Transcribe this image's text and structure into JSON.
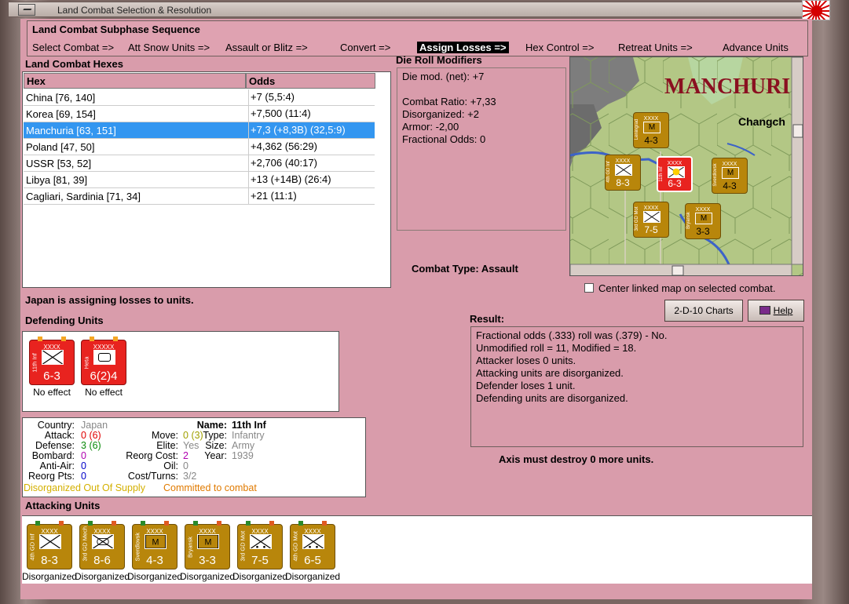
{
  "window": {
    "title": "Land Combat Selection & Resolution"
  },
  "subphase": {
    "header": "Land Combat Subphase Sequence",
    "steps": [
      "Select Combat =>",
      "Att Snow Units =>",
      "Assault or Blitz =>",
      "Convert =>",
      "Assign Losses =>",
      "Hex Control =>",
      "Retreat Units =>",
      "Advance Units"
    ],
    "active_step": "Assign Losses =>"
  },
  "hexes": {
    "label": "Land Combat Hexes",
    "columns": [
      "Hex",
      "Odds"
    ],
    "rows": [
      {
        "hex": "China [76, 140]",
        "odds": "+7 (5,5:4)"
      },
      {
        "hex": "Korea [69, 154]",
        "odds": "+7,500 (11:4)"
      },
      {
        "hex": "Manchuria [63, 151]",
        "odds": "+7,3 (+8,3B) (32,5:9)",
        "selected": true
      },
      {
        "hex": "Poland [47, 50]",
        "odds": "+4,362 (56:29)"
      },
      {
        "hex": "USSR [53, 52]",
        "odds": "+2,706 (40:17)"
      },
      {
        "hex": "Libya [81, 39]",
        "odds": "+13 (+14B) (26:4)"
      },
      {
        "hex": "Cagliari, Sardinia [71, 34]",
        "odds": "+21 (11:1)"
      }
    ]
  },
  "die_roll": {
    "label": "Die Roll Modifiers",
    "lines": [
      "Die mod. (net): +7",
      "",
      "Combat Ratio: +7,33",
      "Disorganized: +2",
      "Armor: -2,00",
      "Fractional Odds: 0"
    ]
  },
  "combat_type": "Combat Type:  Assault",
  "map": {
    "region_label": "MANCHURI",
    "city_label": "Changch",
    "center_checkbox_label": "Center linked map on selected combat."
  },
  "buttons": {
    "charts": "2-D-10 Charts",
    "help": "Help"
  },
  "status_message": "Japan is assigning losses to units.",
  "defending": {
    "label": "Defending Units",
    "units": [
      {
        "size": "XXXX",
        "name": "11th Inf",
        "strength": "6-3",
        "status": "No effect",
        "symbol": "infantry"
      },
      {
        "size": "XXXXX",
        "name": "Heta",
        "strength": "6(2)4",
        "status": "No effect",
        "symbol": "hq"
      }
    ]
  },
  "unit_info": {
    "country_label": "Country:",
    "country": "Japan",
    "attack_label": "Attack:",
    "attack": "0",
    "attack_paren": "(6)",
    "defense_label": "Defense:",
    "defense": "3",
    "defense_paren": "(6)",
    "bombard_label": "Bombard:",
    "bombard": "0",
    "antiair_label": "Anti-Air:",
    "antiair": "0",
    "reorgpts_label": "Reorg Pts:",
    "reorgpts": "0",
    "name_label": "Name:",
    "name": "11th Inf",
    "move_label": "Move:",
    "move": "0",
    "move_paren": "(3)",
    "type_label": "Type:",
    "type": "Infantry",
    "elite_label": "Elite:",
    "elite": "Yes",
    "size_label": "Size:",
    "size": "Army",
    "reorgcost_label": "Reorg Cost:",
    "reorgcost": "2",
    "year_label": "Year:",
    "year": "1939",
    "oil_label": "Oil:",
    "oil": "0",
    "costturns_label": "Cost/Turns:",
    "costturns": "3/2",
    "flags_yellow": "Disorganized Out Of Supply",
    "flags_orange": "Committed to combat"
  },
  "result": {
    "label": "Result:",
    "lines": [
      "Fractional odds (.333) roll was (.379)  -  No.",
      "Unmodified roll = 11, Modified = 18.",
      "Attacker loses 0 units.",
      "Attacking units are disorganized.",
      "Defender loses 1 unit.",
      "Defending units are disorganized."
    ],
    "footer": "Axis must destroy 0 more units."
  },
  "attacking": {
    "label": "Attacking Units",
    "units": [
      {
        "size": "XXXX",
        "name": "4th GD Inf",
        "strength": "8-3",
        "status": "Disorganized",
        "symbol": "infantry"
      },
      {
        "size": "XXXX",
        "name": "3rd GD Mech",
        "strength": "8-6",
        "status": "Disorganized",
        "symbol": "infantry"
      },
      {
        "size": "XXXX",
        "name": "Sverdlovsk",
        "strength": "4-3",
        "status": "Disorganized",
        "symbol": "militia"
      },
      {
        "size": "XXXX",
        "name": "Bryansk",
        "strength": "3-3",
        "status": "Disorganized",
        "symbol": "militia"
      },
      {
        "size": "XXXX",
        "name": "3rd GD Mot",
        "strength": "7-5",
        "status": "Disorganized",
        "symbol": "motorized"
      },
      {
        "size": "XXXX",
        "name": "4th GD Mot",
        "strength": "6-5",
        "status": "Disorganized",
        "symbol": "motorized"
      }
    ]
  },
  "map_counters": [
    {
      "name": "Leningrad",
      "strength": "4-3"
    },
    {
      "name": "4th GD Inf",
      "strength": "8-3"
    },
    {
      "name": "11th Inf",
      "strength": "6-3"
    },
    {
      "name": "Sverdlovsk",
      "strength": "4-3"
    },
    {
      "name": "3rd GD Mot",
      "strength": "7-5"
    },
    {
      "name": "Bryansk",
      "strength": "3-3"
    }
  ],
  "colors": {
    "panel": "#d99cab",
    "selected_row": "#3396f0",
    "japan_red": "#e8231f",
    "soviet_brown": "#b8860b"
  }
}
